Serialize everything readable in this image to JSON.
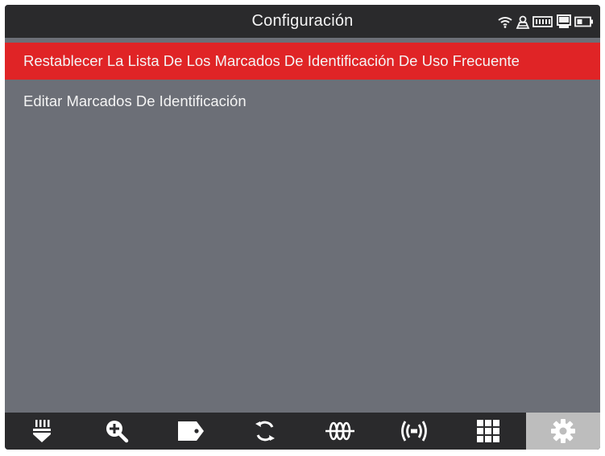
{
  "header": {
    "title": "Configuración",
    "status_icons": [
      "wifi-icon",
      "alert-person-icon",
      "battery-tool-icon",
      "printer-icon",
      "battery-icon"
    ]
  },
  "menu": {
    "items": [
      {
        "label": "Restablecer La Lista De Los Marcados De Identificación De Uso Frecuente",
        "selected": true
      },
      {
        "label": "Editar Marcados De Identificación",
        "selected": false
      }
    ]
  },
  "bottom_nav": {
    "tabs": [
      {
        "icon": "plug-icon",
        "active": false
      },
      {
        "icon": "zoom-plus-icon",
        "active": false
      },
      {
        "icon": "tag-icon",
        "active": false
      },
      {
        "icon": "refresh-icon",
        "active": false
      },
      {
        "icon": "coil-icon",
        "active": false
      },
      {
        "icon": "signal-icon",
        "active": false
      },
      {
        "icon": "grid-icon",
        "active": false
      },
      {
        "icon": "gear-icon",
        "active": true
      }
    ]
  },
  "colors": {
    "background": "#6c6f77",
    "bar": "#2a2a2c",
    "selected": "#e02426",
    "active_tab": "#bdbdbd",
    "text": "#f4f4f4"
  }
}
